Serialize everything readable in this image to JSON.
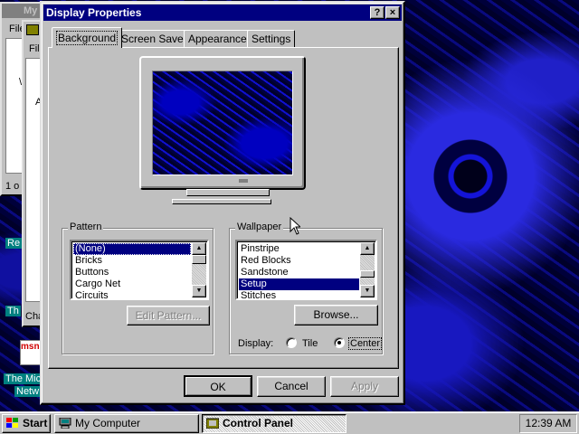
{
  "dialog": {
    "title": "Display Properties",
    "help_button": "?",
    "close_button": "×",
    "tabs": [
      {
        "label": "Background",
        "active": true
      },
      {
        "label": "Screen Saver",
        "active": false
      },
      {
        "label": "Appearance",
        "active": false
      },
      {
        "label": "Settings",
        "active": false
      }
    ],
    "pattern": {
      "label": "Pattern",
      "items": [
        "(None)",
        "Bricks",
        "Buttons",
        "Cargo Net",
        "Circuits"
      ],
      "selected": "(None)",
      "edit_button": "Edit Pattern..."
    },
    "wallpaper": {
      "label": "Wallpaper",
      "items": [
        "Pinstripe",
        "Red Blocks",
        "Sandstone",
        "Setup",
        "Stitches"
      ],
      "selected": "Setup",
      "browse_button": "Browse...",
      "display_label": "Display:",
      "tile_label": "Tile",
      "center_label": "Center",
      "display_mode": "Center"
    },
    "ok_button": "OK",
    "cancel_button": "Cancel",
    "apply_button": "Apply"
  },
  "background_windows": {
    "window1_title": "My",
    "window1_menu": "File",
    "window1_text": "\\",
    "window1_status": "1 o",
    "window2_menu": "File",
    "window2_text": "A",
    "window2_status": "Cha"
  },
  "desktop": {
    "label_re": "Re",
    "label_th": "Th",
    "msn_label": "msn",
    "label_the_mic": "The Mic",
    "label_netw": "Netw"
  },
  "taskbar": {
    "start_label": "Start",
    "items": [
      {
        "label": "My Computer",
        "active": false
      },
      {
        "label": "Control Panel",
        "active": true
      }
    ],
    "clock": "12:39 AM"
  },
  "colors": {
    "titlebar_active": "#000080",
    "face": "#c0c0c0",
    "desktop_blue": "#0000c0"
  }
}
